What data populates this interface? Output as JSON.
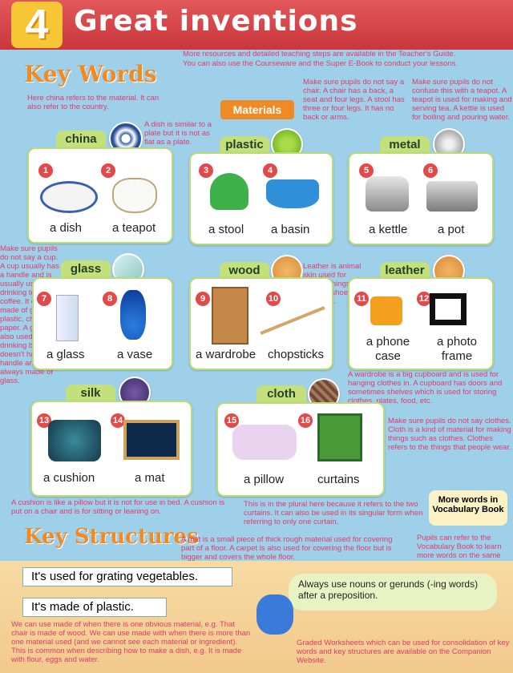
{
  "header": {
    "unit": "4",
    "title": "Great inventions"
  },
  "section_key_words": "Key Words",
  "section_key_structures": "Key Structures",
  "materials_label": "Materials",
  "teacher_note": [
    "More resources and detailed teaching steps are available in the Teacher's Guide.",
    "You can also use the Courseware and the Super E-Book to conduct your lessons."
  ],
  "notes": {
    "china": "Here china refers to the material. It can also refer to the country.",
    "dish": "A dish is similar to a plate but it is not as flat as a plate.",
    "chair": "Make sure pupils do not say a chair. A chair has a back, a seat and four legs. A stool has three or four legs. It has no back or arms.",
    "teapot": "Make sure pupils do not confuse this with a teapot. A teapot is used for making and serving tea. A kettle is used for boiling and pouring water.",
    "cup": "Make sure pupils do not say a cup. A cup usually has a handle and is usually used for drinking tea or coffee. It can be made of glass, plastic, china or paper. A glass is also used for drinking but it doesn't have a handle and is always made of glass.",
    "leather": "Leather is animal skin used for making things such as shoes, bags, etc.",
    "wardrobe": "A wardrobe is a big cupboard and is used for hanging clothes in. A cupboard has doors and sometimes shelves which is used for storing clothes, plates, food, etc.",
    "clothes": "Make sure pupils do not say clothes. Cloth is a kind of material for making things such as clothes. Clothes refers to the things that people wear.",
    "cushion": "A cushion is like a pillow but it is not for use in bed. A cushion is put on a chair and is for sitting or leaning on.",
    "curtains": "This is in the plural here because it refers to the two curtains. It can also be used in its singular form when referring to only one curtain.",
    "mat": "A mat is a small piece of thick rough material used for covering part of a floor. A carpet is also used for covering the floor but is bigger and covers the whole floor.",
    "vocab": "Pupils can refer to the Vocabulary Book to learn more words on the same theme.",
    "made_of": "We can use made of when there is one obvious material, e.g. That chair is made of wood. We can use made with when there is more than one material used (and we cannot see each material or ingredient). This is common when describing how to make a dish, e.g. It is made with flour, eggs and water.",
    "graded": "Graded Worksheets which can be used for consolidation of key words and key structures are available on the Companion Website."
  },
  "groups": [
    {
      "material": "china",
      "items": [
        {
          "n": "1",
          "word": "a dish"
        },
        {
          "n": "2",
          "word": "a teapot"
        }
      ]
    },
    {
      "material": "plastic",
      "items": [
        {
          "n": "3",
          "word": "a stool"
        },
        {
          "n": "4",
          "word": "a basin"
        }
      ]
    },
    {
      "material": "metal",
      "items": [
        {
          "n": "5",
          "word": "a kettle"
        },
        {
          "n": "6",
          "word": "a pot"
        }
      ]
    },
    {
      "material": "glass",
      "items": [
        {
          "n": "7",
          "word": "a glass"
        },
        {
          "n": "8",
          "word": "a vase"
        }
      ]
    },
    {
      "material": "wood",
      "items": [
        {
          "n": "9",
          "word": "a wardrobe"
        },
        {
          "n": "10",
          "word": "chopsticks"
        }
      ]
    },
    {
      "material": "leather",
      "items": [
        {
          "n": "11",
          "word": "a phone case"
        },
        {
          "n": "12",
          "word": "a photo frame"
        }
      ]
    },
    {
      "material": "silk",
      "items": [
        {
          "n": "13",
          "word": "a cushion"
        },
        {
          "n": "14",
          "word": "a mat"
        }
      ]
    },
    {
      "material": "cloth",
      "items": [
        {
          "n": "15",
          "word": "a pillow"
        },
        {
          "n": "16",
          "word": "curtains"
        }
      ]
    }
  ],
  "structures": [
    "It's used for grating vegetables.",
    "It's made of plastic."
  ],
  "tip": "Always use nouns or gerunds (-ing words) after a preposition.",
  "vocab_badge": "More words in Vocabulary Book",
  "colors": {
    "header": "#d2434a",
    "accent": "#f08a25",
    "note": "#e23a6b",
    "tag": "#c4e07a",
    "background": "#9fd0ea"
  }
}
